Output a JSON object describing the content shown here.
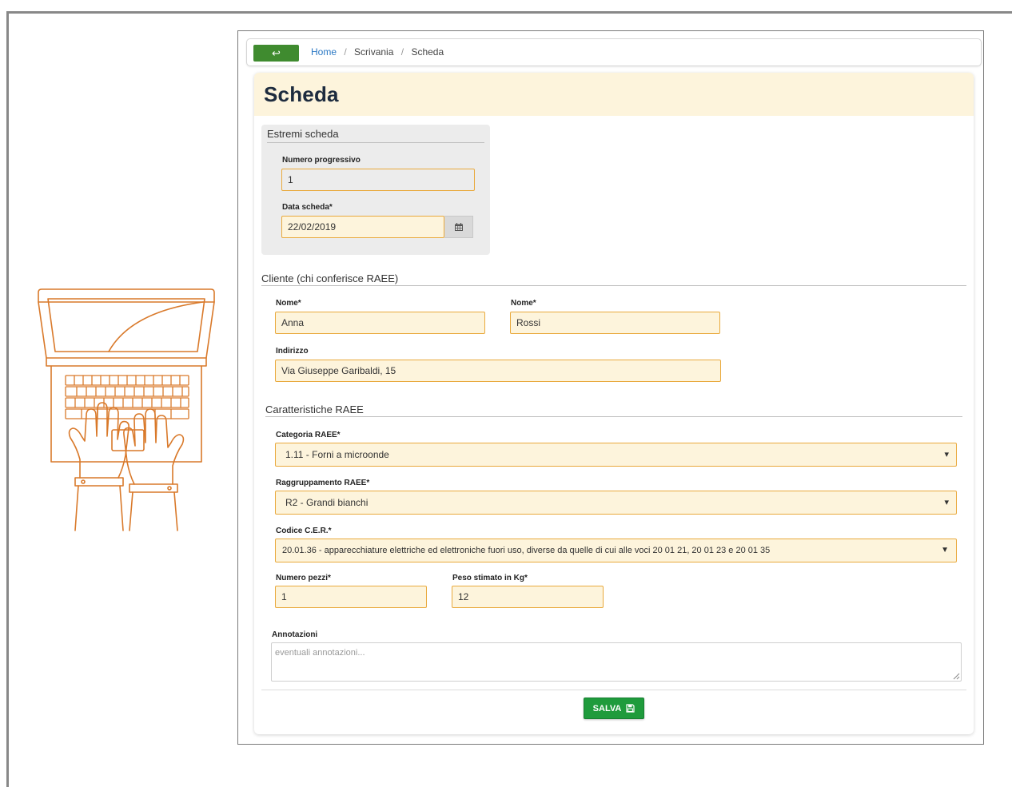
{
  "breadcrumb": {
    "back_label": "↩",
    "items": [
      "Home",
      "Scrivania",
      "Scheda"
    ],
    "separator": "/"
  },
  "page": {
    "title": "Scheda"
  },
  "estremi": {
    "legend": "Estremi scheda",
    "numero_label": "Numero progressivo",
    "numero_value": "1",
    "data_label": "Data scheda*",
    "data_value": "22/02/2019"
  },
  "cliente": {
    "legend": "Cliente (chi conferisce RAEE)",
    "nome_label": "Nome*",
    "nome_value": "Anna",
    "cognome_label": "Nome*",
    "cognome_value": "Rossi",
    "indirizzo_label": "Indirizzo",
    "indirizzo_value": "Via Giuseppe Garibaldi, 15"
  },
  "raee": {
    "legend": "Caratteristiche RAEE",
    "categoria_label": "Categoria RAEE*",
    "categoria_value": "1.11 - Forni a microonde",
    "raggruppamento_label": "Raggruppamento RAEE*",
    "raggruppamento_value": "R2 - Grandi bianchi",
    "cer_label": "Codice C.E.R.*",
    "cer_value": "20.01.36 - apparecchiature elettriche ed elettroniche fuori uso, diverse da quelle di cui alle voci 20 01 21, 20 01 23 e 20 01 35",
    "pezzi_label": "Numero pezzi*",
    "pezzi_value": "1",
    "peso_label": "Peso stimato in Kg*",
    "peso_value": "12",
    "annotazioni_label": "Annotazioni",
    "annotazioni_placeholder": "eventuali annotazioni..."
  },
  "actions": {
    "save_label": "SALVA"
  },
  "colors": {
    "accent_green": "#3f8b2f",
    "save_green": "#1f9b3c",
    "field_bg": "#fdf4dc",
    "field_border": "#e9a93c",
    "illustration": "#d9792a",
    "link": "#2a78c4"
  },
  "icons": {
    "back": "back-arrow-icon",
    "calendar": "calendar-icon",
    "caret": "caret-down-icon",
    "save": "floppy-disk-icon",
    "illustration": "laptop-typing-hands-icon"
  }
}
